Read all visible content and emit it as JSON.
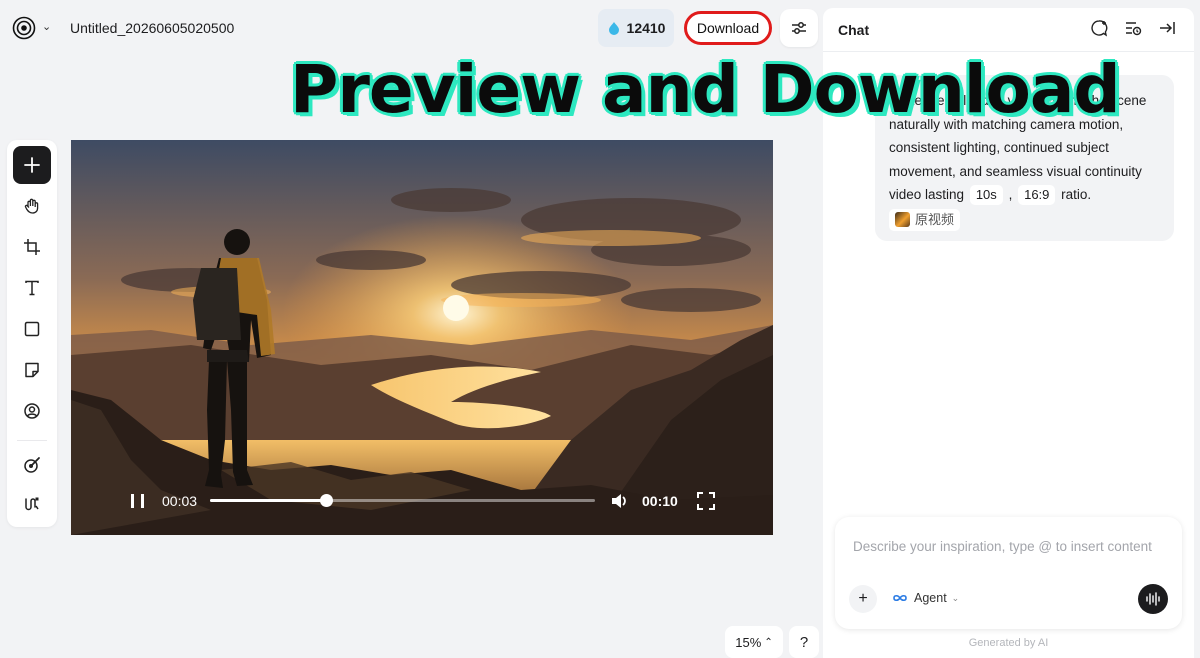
{
  "header": {
    "doc_title": "Untitled_20260605020500",
    "credits": "12410",
    "download_label": "Download"
  },
  "overlay": {
    "headline": "Preview and Download"
  },
  "toolbar": {
    "items": [
      "add",
      "hand",
      "crop",
      "text",
      "rectangle",
      "sticky-note",
      "person",
      "style",
      "audio"
    ]
  },
  "player": {
    "current_time": "00:03",
    "duration": "00:10",
    "progress_fraction": 0.3
  },
  "canvas": {
    "zoom": "15%",
    "help": "?"
  },
  "chat": {
    "title": "Chat",
    "message": {
      "text_before": "Make the uploaded video extend the scene naturally with matching camera motion, consistent lighting, continued subject movement, and seamless visual continuity video lasting",
      "duration_chip": "10s",
      "separator": ",",
      "ratio_chip": "16:9",
      "text_after": "ratio.",
      "reference_label": "原视频"
    },
    "composer": {
      "placeholder": "Describe your inspiration, type @ to insert content",
      "agent_label": "Agent"
    },
    "footer": "Generated by AI"
  }
}
